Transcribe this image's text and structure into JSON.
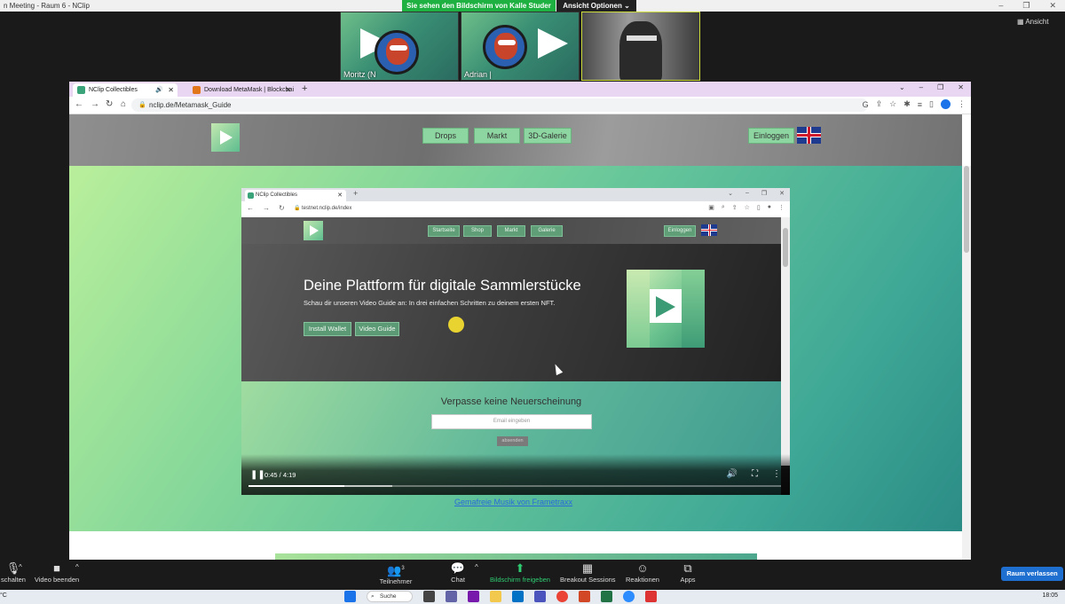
{
  "window": {
    "title": "n Meeting - Raum 6 - NClip",
    "controls": [
      "–",
      "❐",
      "✕"
    ]
  },
  "banner": {
    "sharing_text": "Sie sehen den Bildschirm von Kalle Studer",
    "view_options": "Ansicht Optionen ⌄",
    "ansicht": "Ansicht"
  },
  "participants": [
    {
      "name": "Moritz (N"
    },
    {
      "name": "Adrian | "
    },
    {
      "name": ""
    }
  ],
  "browser": {
    "tabs": [
      {
        "label": "NClip Collectibles",
        "close": "✕",
        "audio": "🔊"
      },
      {
        "label": "Download MetaMask | Blockchai",
        "close": "✕"
      }
    ],
    "new_tab": "+",
    "url": "nclip.de/Metamask_Guide",
    "window_controls": [
      "⌄",
      "–",
      "❐",
      "✕"
    ],
    "nav": {
      "back": "←",
      "forward": "→",
      "reload": "↻",
      "home": "⌂"
    }
  },
  "site": {
    "nav": [
      "Drops",
      "Markt",
      "3D-Galerie"
    ],
    "login": "Einloggen",
    "music_link": "Gemafreie Musik von Frametraxx"
  },
  "video": {
    "tab_label": "NClip Collectibles",
    "url": "testnet.nclip.de/index",
    "nav": [
      "Startseite",
      "Shop",
      "Markt",
      "Galerie"
    ],
    "login": "Einloggen",
    "hero_title": "Deine Plattform für digitale Sammlerstücke",
    "hero_subtitle": "Schau dir unseren Video Guide an: In drei einfachen Schritten zu deinem ersten NFT.",
    "hero_buttons": [
      "Install Wallet",
      "Video Guide"
    ],
    "newsletter_title": "Verpasse keine Neuerscheinung",
    "email_placeholder": "Email eingeben",
    "submit": "absenden",
    "time": "0:45 / 4:19",
    "progress_played": 0.18,
    "progress_buffered": 0.27
  },
  "toolbar": {
    "mute_label": "schalten",
    "video_label": "Video beenden",
    "participants_label": "Teilnehmer",
    "participants_count": "3",
    "chat_label": "Chat",
    "share_label": "Bildschirm freigeben",
    "breakout_label": "Breakout Sessions",
    "reactions_label": "Reaktionen",
    "apps_label": "Apps",
    "leave_label": "Raum verlassen"
  },
  "taskbar": {
    "temp": "°C",
    "search": "Suche",
    "clock": "18:05"
  },
  "colors": {
    "accent_green": "#1eb141",
    "leave_blue": "#1f6fd1",
    "nav_button": "#8ed6a1"
  }
}
